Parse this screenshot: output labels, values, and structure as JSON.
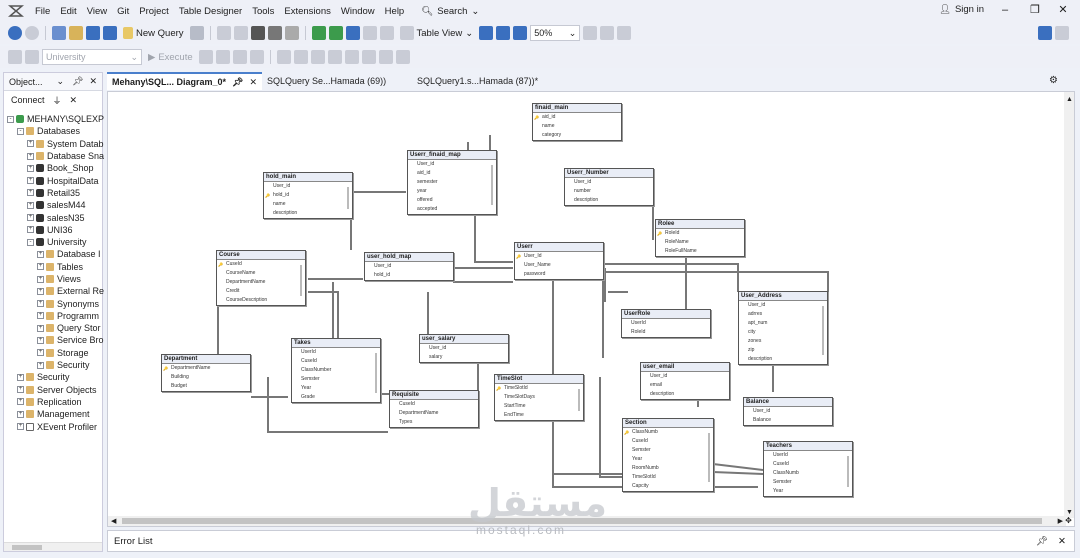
{
  "menubar": {
    "items": [
      "File",
      "Edit",
      "View",
      "Git",
      "Project",
      "Table Designer",
      "Tools",
      "Extensions",
      "Window",
      "Help"
    ],
    "search_label": "Search",
    "signin_label": "Sign in"
  },
  "toolbar": {
    "new_query_label": "New Query",
    "table_view_label": "Table View",
    "zoom_value": "50%",
    "database_value": "University",
    "execute_label": "Execute"
  },
  "object_explorer": {
    "title": "Object...",
    "connect_label": "Connect",
    "server": "MEHANY\\SQLEXPR",
    "tree": [
      {
        "label": "MEHANY\\SQLEXPR",
        "level": 0,
        "icon": "server-icon",
        "exp": "-"
      },
      {
        "label": "Databases",
        "level": 1,
        "icon": "folder-icon",
        "exp": "-"
      },
      {
        "label": "System Datab",
        "level": 2,
        "icon": "folder-icon",
        "exp": "+"
      },
      {
        "label": "Database Sna",
        "level": 2,
        "icon": "folder-icon",
        "exp": "+"
      },
      {
        "label": "Book_Shop",
        "level": 2,
        "icon": "database-icon",
        "exp": "+"
      },
      {
        "label": "HospitalData",
        "level": 2,
        "icon": "database-icon",
        "exp": "+"
      },
      {
        "label": "Retail35",
        "level": 2,
        "icon": "database-icon",
        "exp": "+"
      },
      {
        "label": "salesM44",
        "level": 2,
        "icon": "database-icon",
        "exp": "+"
      },
      {
        "label": "salesN35",
        "level": 2,
        "icon": "database-icon",
        "exp": "+"
      },
      {
        "label": "UNI36",
        "level": 2,
        "icon": "database-icon",
        "exp": "+"
      },
      {
        "label": "University",
        "level": 2,
        "icon": "database-icon",
        "exp": "-"
      },
      {
        "label": "Database I",
        "level": 3,
        "icon": "folder-icon",
        "exp": "+"
      },
      {
        "label": "Tables",
        "level": 3,
        "icon": "folder-icon",
        "exp": "+"
      },
      {
        "label": "Views",
        "level": 3,
        "icon": "folder-icon",
        "exp": "+"
      },
      {
        "label": "External Re",
        "level": 3,
        "icon": "folder-icon",
        "exp": "+"
      },
      {
        "label": "Synonyms",
        "level": 3,
        "icon": "folder-icon",
        "exp": "+"
      },
      {
        "label": "Programm",
        "level": 3,
        "icon": "folder-icon",
        "exp": "+"
      },
      {
        "label": "Query Stor",
        "level": 3,
        "icon": "folder-icon",
        "exp": "+"
      },
      {
        "label": "Service Bro",
        "level": 3,
        "icon": "folder-icon",
        "exp": "+"
      },
      {
        "label": "Storage",
        "level": 3,
        "icon": "folder-icon",
        "exp": "+"
      },
      {
        "label": "Security",
        "level": 3,
        "icon": "folder-icon",
        "exp": "+"
      },
      {
        "label": "Security",
        "level": 1,
        "icon": "folder-icon",
        "exp": "+"
      },
      {
        "label": "Server Objects",
        "level": 1,
        "icon": "folder-icon",
        "exp": "+"
      },
      {
        "label": "Replication",
        "level": 1,
        "icon": "folder-icon",
        "exp": "+"
      },
      {
        "label": "Management",
        "level": 1,
        "icon": "folder-icon",
        "exp": "+"
      },
      {
        "label": "XEvent Profiler",
        "level": 1,
        "icon": "profiler-icon",
        "exp": "+"
      }
    ]
  },
  "tabs": [
    {
      "label": "Mehany\\SQL... Diagram_0*",
      "active": true
    },
    {
      "label": "SQLQuery Se...Hamada (69))",
      "active": false
    },
    {
      "label": "SQLQuery1.s...Hamada (87))*",
      "active": false
    }
  ],
  "diagram": {
    "tables": [
      {
        "name": "finaid_main",
        "cols": [
          "aid_id",
          "name",
          "category"
        ],
        "pk": [
          0
        ]
      },
      {
        "name": "Userr_finaid_map",
        "cols": [
          "User_id",
          "aid_id",
          "semester",
          "year",
          "offered",
          "accepted"
        ],
        "pk": []
      },
      {
        "name": "hold_main",
        "cols": [
          "User_id",
          "hold_id",
          "name",
          "description"
        ],
        "pk": [
          1
        ]
      },
      {
        "name": "Userr_Number",
        "cols": [
          "User_id",
          "number",
          "description"
        ],
        "pk": []
      },
      {
        "name": "Rolee",
        "cols": [
          "RoleId",
          "RoleName",
          "RoleFullName"
        ],
        "pk": [
          0
        ]
      },
      {
        "name": "Course",
        "cols": [
          "CuseId",
          "CourseName",
          "DepartmentName",
          "Credit",
          "CourseDescription"
        ],
        "pk": [
          0
        ]
      },
      {
        "name": "user_hold_map",
        "cols": [
          "User_id",
          "hold_id"
        ],
        "pk": []
      },
      {
        "name": "Userr",
        "cols": [
          "User_Id",
          "User_Name",
          "password"
        ],
        "pk": [
          0
        ]
      },
      {
        "name": "User_Address",
        "cols": [
          "User_id",
          "adrres",
          "apt_num",
          "city",
          "zones",
          "zip",
          "description"
        ],
        "pk": []
      },
      {
        "name": "UserRole",
        "cols": [
          "UserId",
          "RoleId"
        ],
        "pk": []
      },
      {
        "name": "Department",
        "cols": [
          "DepartmentName",
          "Building",
          "Budget"
        ],
        "pk": [
          0
        ]
      },
      {
        "name": "Takes",
        "cols": [
          "UserId",
          "CuseId",
          "ClassNumber",
          "Semster",
          "Year",
          "Grade"
        ],
        "pk": []
      },
      {
        "name": "user_salary",
        "cols": [
          "User_id",
          "salary"
        ],
        "pk": []
      },
      {
        "name": "user_email",
        "cols": [
          "User_id",
          "email",
          "description"
        ],
        "pk": []
      },
      {
        "name": "Balance",
        "cols": [
          "User_id",
          "Balance"
        ],
        "pk": []
      },
      {
        "name": "Requisite",
        "cols": [
          "CuseId",
          "DepartmentName",
          "Types"
        ],
        "pk": []
      },
      {
        "name": "TimeSlot",
        "cols": [
          "TimeSlotId",
          "TimeSlotDays",
          "StartTime",
          "EndTime"
        ],
        "pk": [
          0
        ]
      },
      {
        "name": "Section",
        "cols": [
          "ClassNumb",
          "CuseId",
          "Semster",
          "Year",
          "RoomNumb",
          "TimeSlotId",
          "Capcity"
        ],
        "pk": [
          0
        ]
      },
      {
        "name": "Teachers",
        "cols": [
          "UserId",
          "CuseId",
          "ClassNumb",
          "Semster",
          "Year"
        ],
        "pk": []
      }
    ]
  },
  "error_list_label": "Error List",
  "watermark": {
    "text": "مستقل",
    "sub": "mostaql.com"
  }
}
